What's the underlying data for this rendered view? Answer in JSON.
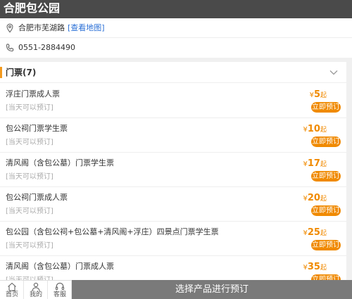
{
  "header": {
    "title": "合肥包公园"
  },
  "info": {
    "address": "合肥市芜湖路",
    "map_link": "[查看地图]",
    "phone": "0551-2884490"
  },
  "tickets_section": {
    "title": "门票(7)",
    "items": [
      {
        "name": "浮庄门票成人票",
        "note": "[当天可以预订]",
        "currency": "¥",
        "price": "5",
        "suffix": "起",
        "button": "立即预订"
      },
      {
        "name": "包公祠门票学生票",
        "note": "[当天可以预订]",
        "currency": "¥",
        "price": "10",
        "suffix": "起",
        "button": "立即预订"
      },
      {
        "name": "清风阁（含包公墓）门票学生票",
        "note": "[当天可以预订]",
        "currency": "¥",
        "price": "17",
        "suffix": "起",
        "button": "立即预订"
      },
      {
        "name": "包公祠门票成人票",
        "note": "[当天可以预订]",
        "currency": "¥",
        "price": "20",
        "suffix": "起",
        "button": "立即预订"
      },
      {
        "name": "包公园（含包公祠+包公墓+清风阁+浮庄）四景点门票学生票",
        "note": "[当天可以预订]",
        "currency": "¥",
        "price": "25",
        "suffix": "起",
        "button": "立即预订"
      },
      {
        "name": "清风阁（含包公墓）门票成人票",
        "note": "[当天可以预订]",
        "currency": "¥",
        "price": "35",
        "suffix": "起",
        "button": "立即预订"
      }
    ]
  },
  "footer": {
    "tabs": [
      {
        "label": "首页",
        "icon": "home-icon"
      },
      {
        "label": "我的",
        "icon": "user-icon"
      },
      {
        "label": "客服",
        "icon": "headset-icon"
      }
    ],
    "cta": "选择产品进行预订"
  },
  "colors": {
    "accent": "#f08a00",
    "header_bg": "#4a4a4a",
    "link": "#2a6fd6",
    "cta_bg": "#7a7a7a"
  }
}
